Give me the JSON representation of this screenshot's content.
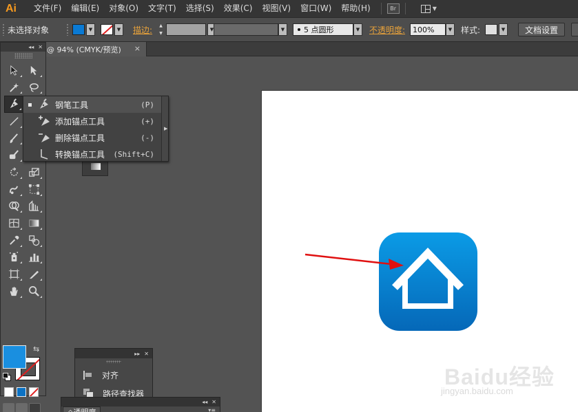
{
  "app": {
    "logo": "Ai",
    "bridge_badge": "Br"
  },
  "menubar": {
    "items": [
      {
        "label": "文件(F)"
      },
      {
        "label": "编辑(E)"
      },
      {
        "label": "对象(O)"
      },
      {
        "label": "文字(T)"
      },
      {
        "label": "选择(S)"
      },
      {
        "label": "效果(C)"
      },
      {
        "label": "视图(V)"
      },
      {
        "label": "窗口(W)"
      },
      {
        "label": "帮助(H)"
      }
    ]
  },
  "controlbar": {
    "selection_label": "未选择对象",
    "fill_color": "#0a7ad4",
    "stroke_label": "描边:",
    "brush_value": "5 点圆形",
    "opacity_label": "不透明度:",
    "opacity_value": "100%",
    "style_label": "样式:",
    "doc_setup_label": "文档设置"
  },
  "document_tab": {
    "title": "@ 94% (CMYK/预览)",
    "close_symbol": "×"
  },
  "toolbox": {
    "tools": [
      [
        "selection-tool-icon",
        "direct-selection-tool-icon"
      ],
      [
        "magic-wand-tool-icon",
        "lasso-tool-icon"
      ],
      [
        "pen-tool-icon",
        "type-tool-icon"
      ],
      [
        "line-segment-tool-icon",
        "rectangle-tool-icon"
      ],
      [
        "paintbrush-tool-icon",
        "pencil-tool-icon"
      ],
      [
        "blob-brush-tool-icon",
        "eraser-tool-icon"
      ],
      [
        "rotate-tool-icon",
        "scale-tool-icon"
      ],
      [
        "warp-tool-icon",
        "free-transform-tool-icon"
      ],
      [
        "shape-builder-tool-icon",
        "perspective-grid-tool-icon"
      ],
      [
        "mesh-tool-icon",
        "gradient-tool-icon"
      ],
      [
        "eyedropper-tool-icon",
        "blend-tool-icon"
      ],
      [
        "symbol-sprayer-tool-icon",
        "column-graph-tool-icon"
      ],
      [
        "artboard-tool-icon",
        "slice-tool-icon"
      ],
      [
        "hand-tool-icon",
        "zoom-tool-icon"
      ]
    ],
    "fill_color": "#1a8fe0",
    "stroke_color": "none"
  },
  "pen_flyout": {
    "items": [
      {
        "label": "钢笔工具",
        "shortcut": "(P)",
        "icon": "pen-icon",
        "selected": true
      },
      {
        "label": "添加锚点工具",
        "shortcut": "(+)",
        "icon": "add-anchor-point-icon",
        "selected": false
      },
      {
        "label": "删除锚点工具",
        "shortcut": "(-)",
        "icon": "delete-anchor-point-icon",
        "selected": false
      },
      {
        "label": "转换锚点工具",
        "shortcut": "(Shift+C)",
        "icon": "convert-anchor-point-icon",
        "selected": false
      }
    ]
  },
  "align_panel": {
    "items": [
      {
        "label": "对齐",
        "icon": "align-icon"
      },
      {
        "label": "路径查找器",
        "icon": "pathfinder-icon"
      }
    ]
  },
  "transparency_panel": {
    "tab_label": "◇透明度"
  },
  "artwork": {
    "icon_colors": {
      "top": "#0b9be6",
      "bottom": "#0568b8",
      "house": "#ffffff"
    },
    "arrow_color": "#e01010"
  },
  "watermark": {
    "main": "Baidu经验",
    "sub": "jingyan.baidu.com"
  }
}
